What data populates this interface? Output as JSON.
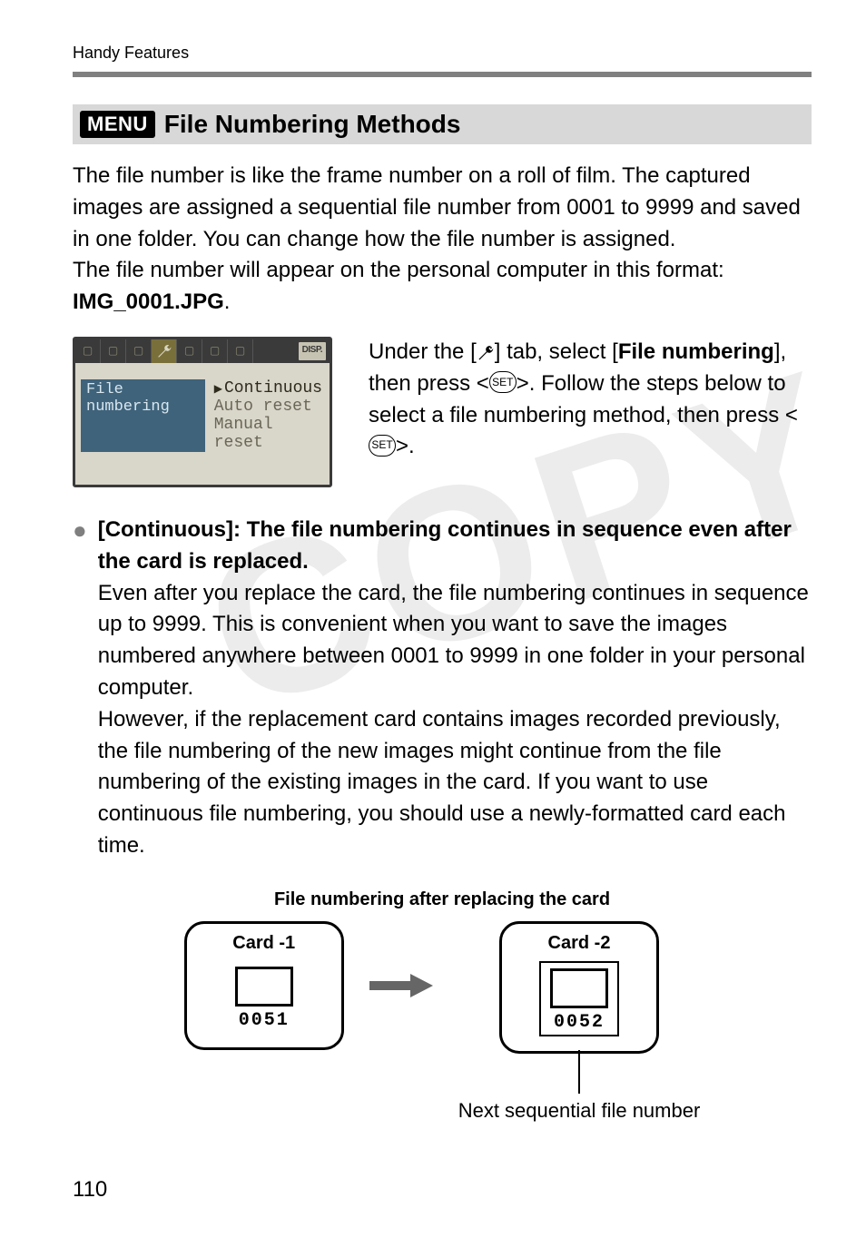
{
  "running_head": "Handy Features",
  "menu_badge": "MENU",
  "section_heading": "File Numbering Methods",
  "intro": {
    "line1": "The file number is like the frame number on a roll of film. The captured images are assigned a sequential file number from 0001 to 9999 and saved in one folder. You can change how the file number is assigned.",
    "line2": "The file number will appear on the personal computer in this format: ",
    "filename": "IMG_0001.JPG",
    "period": "."
  },
  "lcd": {
    "disp_label": "DISP.",
    "menu_item": "File numbering",
    "options": {
      "a": "Continuous",
      "b": "Auto reset",
      "c": "Manual reset"
    }
  },
  "right": {
    "t1": "Under the [",
    "t2": "] tab, select [",
    "t3_bold": "File numbering",
    "t4": "], then press <",
    "t5": ">. Follow the steps below to select a file numbering method, then press <",
    "t6": ">.",
    "set_label": "SET"
  },
  "bullet": {
    "title": "[Continuous]: The file numbering continues in sequence even after the card is replaced.",
    "p1": "Even after you replace the card, the file numbering continues in sequence up to 9999. This is convenient when you want to save the images numbered anywhere between 0001 to 9999 in one folder in your personal computer.",
    "p2": "However, if the replacement card contains images recorded previously, the file numbering of the new images might continue from the file numbering of the existing images in the card. If you want to use continuous file numbering, you should use a newly-formatted card each time."
  },
  "diagram": {
    "title": "File numbering after replacing the card",
    "card1_label": "Card -1",
    "card1_num": "0051",
    "card2_label": "Card -2",
    "card2_num": "0052",
    "caption": "Next sequential file number"
  },
  "page_number": "110"
}
